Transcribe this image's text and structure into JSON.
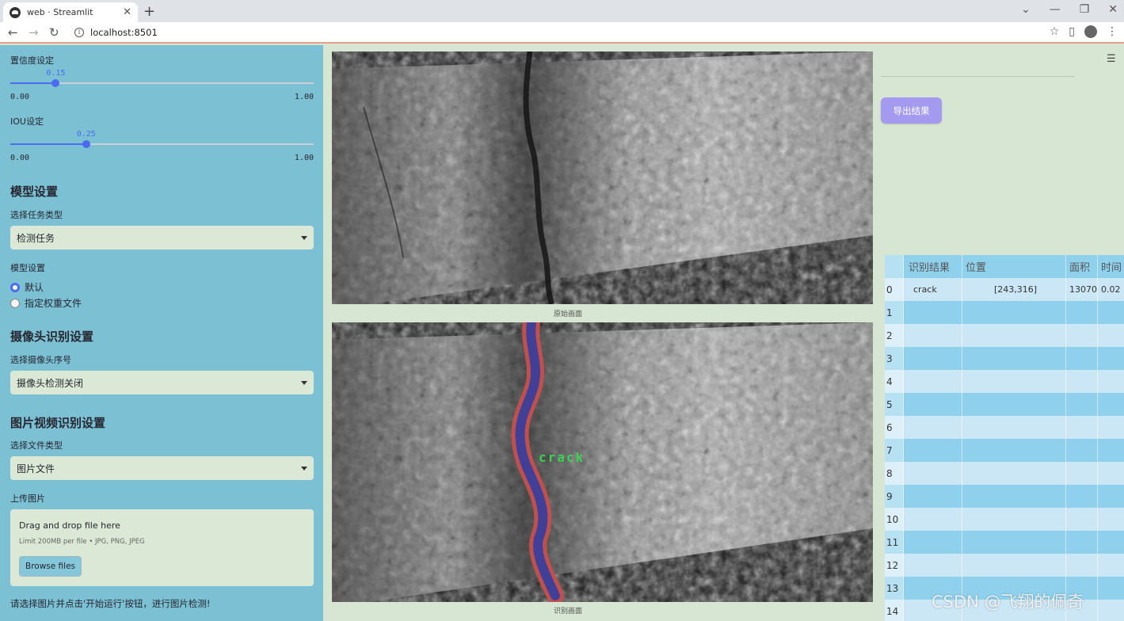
{
  "browser": {
    "tab_title": "web · Streamlit",
    "url": "localhost:8501"
  },
  "sidebar": {
    "conf_label": "置信度设定",
    "conf_slider": {
      "value": "0.15",
      "min": "0.00",
      "max": "1.00",
      "fraction": 0.15
    },
    "iou_label": "IOU设定",
    "iou_slider": {
      "value": "0.25",
      "min": "0.00",
      "max": "1.00",
      "fraction": 0.25
    },
    "model_heading": "模型设置",
    "task_label": "选择任务类型",
    "task_value": "检测任务",
    "model_label": "模型设置",
    "model_options": [
      "默认",
      "指定权重文件"
    ],
    "camera_heading": "摄像头识别设置",
    "camera_label": "选择摄像头序号",
    "camera_value": "摄像头检测关闭",
    "media_heading": "图片视频识别设置",
    "filetype_label": "选择文件类型",
    "filetype_value": "图片文件",
    "upload_label": "上传图片",
    "uploader": {
      "drag_text": "Drag and drop file here",
      "limit_text": "Limit 200MB per file • JPG, PNG, JPEG",
      "browse_label": "Browse files"
    },
    "hint": "请选择图片并点击'开始运行'按钮，进行图片检测!"
  },
  "main": {
    "original_caption": "原始画面",
    "result_caption": "识别画面",
    "detection_label": "crack"
  },
  "right": {
    "export_label": "导出结果"
  },
  "table": {
    "headers": [
      "识别结果",
      "位置",
      "面积",
      "时间"
    ],
    "rows": [
      {
        "idx": "0",
        "result": "crack",
        "position": "[243,316]",
        "area": "13070",
        "time": "0.02"
      },
      {
        "idx": "1"
      },
      {
        "idx": "2"
      },
      {
        "idx": "3"
      },
      {
        "idx": "4"
      },
      {
        "idx": "5"
      },
      {
        "idx": "6"
      },
      {
        "idx": "7"
      },
      {
        "idx": "8"
      },
      {
        "idx": "9"
      },
      {
        "idx": "10"
      },
      {
        "idx": "11"
      },
      {
        "idx": "12"
      },
      {
        "idx": "13"
      },
      {
        "idx": "14"
      }
    ]
  },
  "watermark": "CSDN @飞翔的佩奇",
  "colors": {
    "sidebar_bg": "#7cc0d4",
    "main_bg": "#d6e6d2",
    "accent": "#4a6cf0",
    "export_button": "#a49bf0",
    "mask_outline": "#c0504d",
    "mask_fill": "#3a3f9a",
    "label_text": "#39d353"
  }
}
